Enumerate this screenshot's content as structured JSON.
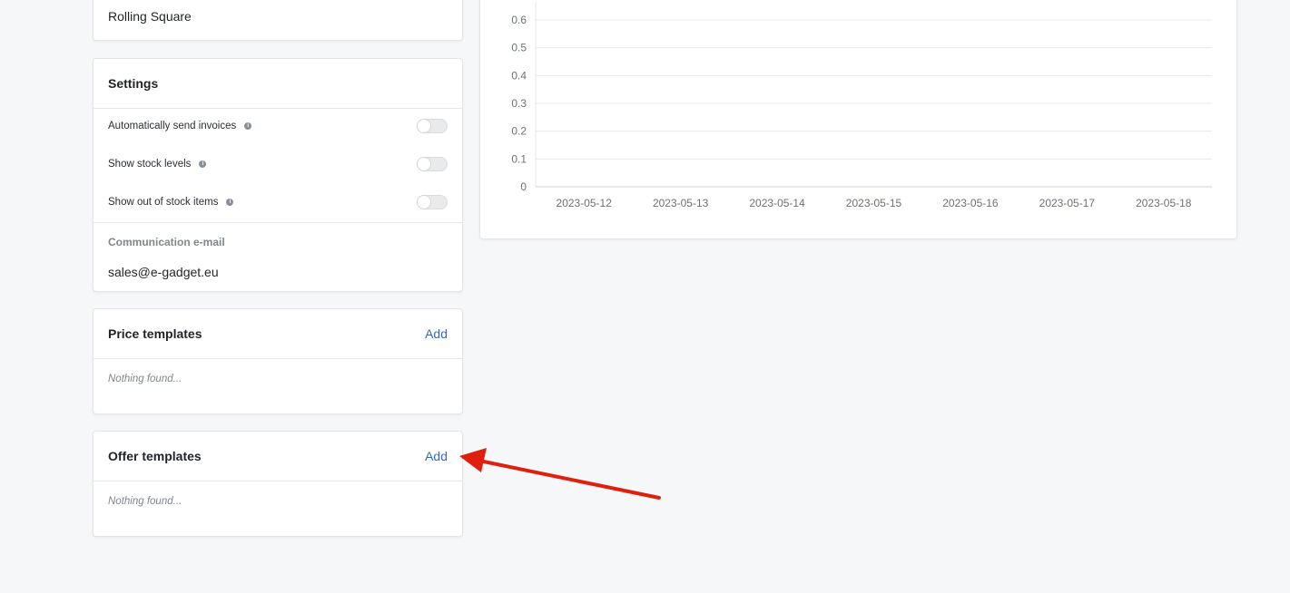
{
  "brand_card": {
    "value": "Rolling Square"
  },
  "settings": {
    "title": "Settings",
    "rows": [
      {
        "label": "Automatically send invoices",
        "enabled": false
      },
      {
        "label": "Show stock levels",
        "enabled": false
      },
      {
        "label": "Show out of stock items",
        "enabled": false
      }
    ],
    "communication_label": "Communication e-mail",
    "communication_email": "sales@e-gadget.eu"
  },
  "price_templates": {
    "title": "Price templates",
    "action": "Add",
    "empty": "Nothing found..."
  },
  "offer_templates": {
    "title": "Offer templates",
    "action": "Add",
    "empty": "Nothing found..."
  },
  "icons": {
    "info": "info-icon",
    "annotation": "red-arrow-icon"
  },
  "colors": {
    "accent": "#2e6ac2",
    "annotation": "#e0200f",
    "background": "#f6f7f9"
  },
  "chart_data": {
    "type": "line",
    "categories": [
      "2023-05-12",
      "2023-05-13",
      "2023-05-14",
      "2023-05-15",
      "2023-05-16",
      "2023-05-17",
      "2023-05-18"
    ],
    "y_ticks": [
      "0",
      "0.1",
      "0.2",
      "0.3",
      "0.4",
      "0.5",
      "0.6"
    ],
    "ylim": [
      0,
      0.6
    ],
    "grid": true,
    "series": [
      {
        "values": [
          0,
          0,
          0,
          0,
          0,
          0,
          0
        ]
      }
    ]
  }
}
